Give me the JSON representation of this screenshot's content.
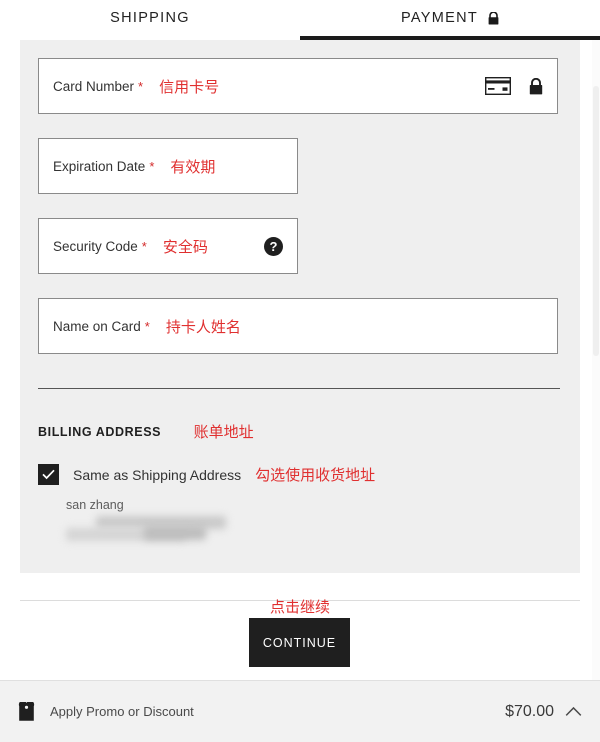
{
  "tabs": [
    {
      "label": "SHIPPING",
      "active": false,
      "icon": ""
    },
    {
      "label": "PAYMENT",
      "active": true,
      "icon": "lock-icon"
    }
  ],
  "payment_form": {
    "card_number": {
      "label": "Card Number",
      "required_mark": "*",
      "annotation": "信用卡号",
      "value": "",
      "icons": [
        "credit-card-icon",
        "lock-icon"
      ]
    },
    "expiration_date": {
      "label": "Expiration Date",
      "required_mark": "*",
      "annotation": "有效期",
      "value": ""
    },
    "security_code": {
      "label": "Security Code",
      "required_mark": "*",
      "annotation": "安全码",
      "value": "",
      "help_icon": "?"
    },
    "name_on_card": {
      "label": "Name on Card",
      "required_mark": "*",
      "annotation": "持卡人姓名",
      "value": ""
    }
  },
  "billing": {
    "title": "BILLING ADDRESS",
    "title_annotation": "账单地址",
    "same_as_shipping": {
      "label": "Same as Shipping Address",
      "annotation": "勾选使用收货地址",
      "checked": true,
      "check_glyph": "✓"
    },
    "address_name": "san zhang"
  },
  "continue": {
    "label": "CONTINUE",
    "annotation": "点击继续"
  },
  "footer": {
    "promo_label": "Apply Promo or Discount",
    "promo_icon": "price-tag-icon",
    "total": "$70.00",
    "expand_icon": "chevron-up-icon"
  },
  "colors": {
    "annotation_red": "#e03030",
    "required_red": "#d32a2a",
    "panel_gray": "#efefef",
    "button_dark": "#1f1f1f",
    "footer_gray": "#f2f2f2"
  }
}
